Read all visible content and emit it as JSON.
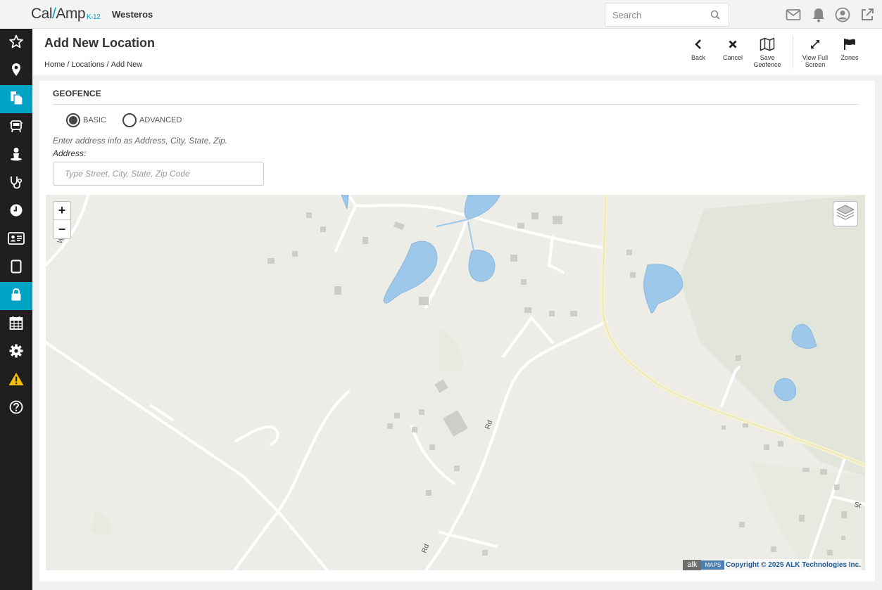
{
  "app": {
    "logo_main_a": "Cal",
    "logo_main_b": "Amp",
    "logo_sub": "K-12",
    "tenant": "Westeros"
  },
  "search": {
    "placeholder": "Search"
  },
  "top_icons": [
    "mail-icon",
    "bell-icon",
    "user-circle-icon",
    "external-link-icon"
  ],
  "sidebar": {
    "items": [
      {
        "icon": "star-icon",
        "active": false
      },
      {
        "icon": "map-pin-icon",
        "active": false
      },
      {
        "icon": "documents-icon",
        "active": true
      },
      {
        "icon": "bus-icon",
        "active": false
      },
      {
        "icon": "person-icon",
        "active": false
      },
      {
        "icon": "stethoscope-icon",
        "active": false
      },
      {
        "icon": "clock-icon",
        "active": false
      },
      {
        "icon": "id-card-icon",
        "active": false
      },
      {
        "icon": "tablet-icon",
        "active": false
      },
      {
        "icon": "lock-icon",
        "active": true
      },
      {
        "icon": "calendar-icon",
        "active": false
      },
      {
        "icon": "gear-icon",
        "active": false
      },
      {
        "icon": "warning-icon",
        "active": false
      },
      {
        "icon": "help-icon",
        "active": false
      }
    ],
    "accent": "#00a3c4"
  },
  "page": {
    "title": "Add New Location",
    "breadcrumb": [
      "Home",
      "Locations",
      "Add New"
    ]
  },
  "toolbar": {
    "back": "Back",
    "cancel": "Cancel",
    "save_geofence_1": "Save",
    "save_geofence_2": "Geofence",
    "view_full_1": "View Full",
    "view_full_2": "Screen",
    "zones": "Zones"
  },
  "geofence": {
    "section_title": "GEOFENCE",
    "radio_basic": "BASIC",
    "radio_advanced": "ADVANCED",
    "selected": "BASIC",
    "hint": "Enter address info as Address, City, State, Zip.",
    "address_label": "Address:",
    "address_placeholder": "Type Street, City, State, Zip Code",
    "address_value": ""
  },
  "map": {
    "zoom_in": "+",
    "zoom_out": "−",
    "attribution_alk": "alk",
    "attribution_maps": "MAPS",
    "attribution_copy": "Copyright © 2025 ALK Technologies Inc.",
    "road_labels": [
      "W Dr",
      "Rd",
      "Rd",
      "St"
    ],
    "water_color": "#9ec8ea",
    "land_color": "#eeece6"
  }
}
